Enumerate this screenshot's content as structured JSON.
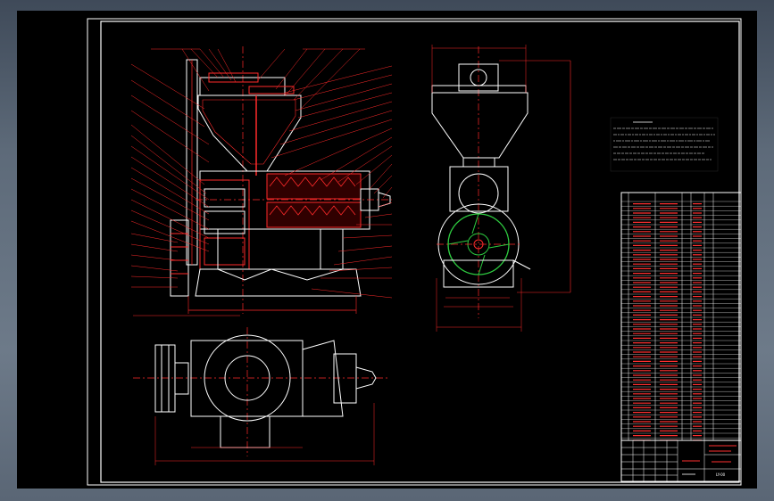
{
  "colors": {
    "background": "#000000",
    "outline": "#ffffff",
    "dimension": "#ff2a2a",
    "centerline": "#ff2a2a",
    "flywheel": "#2ecc40",
    "table_text": "#ff3030"
  },
  "title_block": {
    "drawing_number": "LY-00"
  },
  "icons": {
    "drawing_canvas": "cad-drawing"
  }
}
